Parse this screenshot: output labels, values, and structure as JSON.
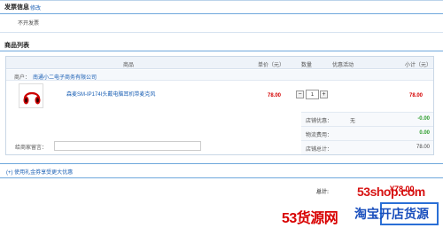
{
  "invoice": {
    "title": "发票信息",
    "edit_label": "修改",
    "value": "不开发票"
  },
  "product_list": {
    "title": "商品列表",
    "columns": [
      "商品",
      "单价（元）",
      "数量",
      "优惠活动",
      "小计（元）"
    ],
    "shop_label": "商户：",
    "shop_name": "南通小二电子商务有限公司",
    "items": [
      {
        "name": "森麦SM-IP174I头戴电脑耳机带麦克风",
        "price": "78.00",
        "qty": "1",
        "subtotal": "78.00",
        "thumb_icon": "red-headphones-image"
      }
    ],
    "summary": {
      "shop_discount_label": "店铺优惠：",
      "shop_discount_mid": "无",
      "shop_discount_value": "-0.00",
      "shipping_label": "物流费用：",
      "shipping_value": "0.00",
      "shop_total_label": "店铺总计：",
      "shop_total_value": "78.00"
    },
    "message_label": "给商家留言："
  },
  "coupon_label": "(+) 使用礼金券享受更大优惠",
  "total_label": "总计:",
  "total_value": "¥78.00",
  "watermarks": {
    "site": "53shop.com",
    "brand_red": "53货源网",
    "brand_blue": "淘宝开店货源"
  },
  "colors": {
    "accent_blue": "#1a5fb4",
    "price_red": "#d40000",
    "discount_green": "#2e9e2e"
  }
}
